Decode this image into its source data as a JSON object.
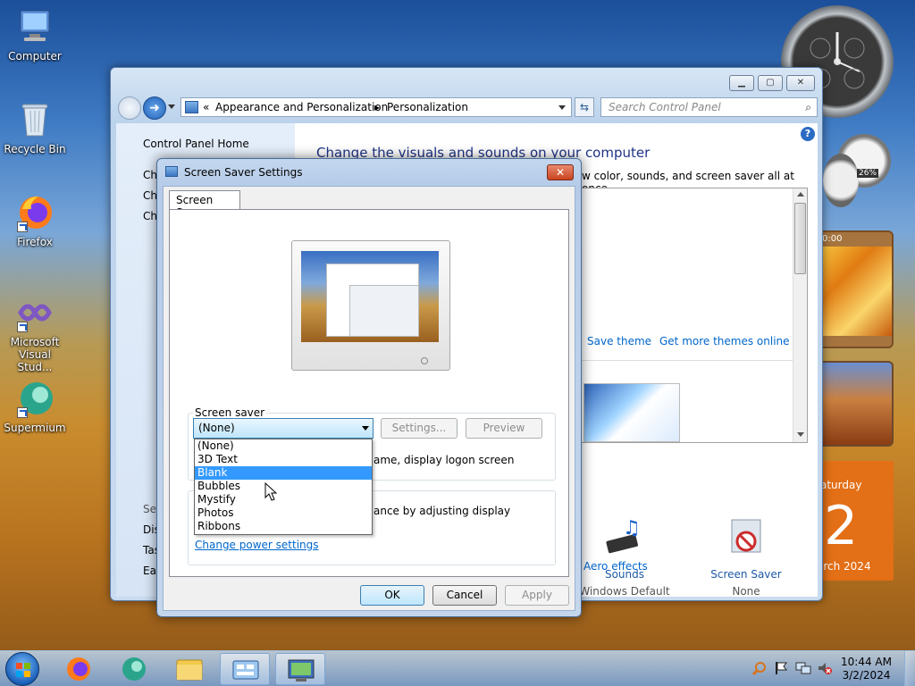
{
  "desktop": {
    "icons": [
      {
        "label": "Computer"
      },
      {
        "label": "Recycle Bin"
      },
      {
        "label": "Firefox"
      },
      {
        "label": "Microsoft Visual Stud..."
      },
      {
        "label": "Supermium"
      }
    ]
  },
  "gadgets": {
    "cpu_meter_value": "26%",
    "calendar_day_name": "aturday",
    "calendar_day": "2",
    "calendar_month": "arch 2024",
    "clock_fragment": "0:00"
  },
  "explorer": {
    "breadcrumb_prefix": "«",
    "breadcrumb": [
      "Appearance and Personalization",
      "Personalization"
    ],
    "search_placeholder": "Search Control Panel",
    "left_pane": {
      "home": "Control Panel Home",
      "partial_items": [
        "Ch",
        "Ch",
        "Ch"
      ],
      "see_also_partial": [
        "See",
        "Dis",
        "Tas",
        "Eas"
      ]
    },
    "heading": "Change the visuals and sounds on your computer",
    "subheading": "w color, sounds, and screen saver all at once.",
    "theme_links": {
      "save": "Save theme",
      "more": "Get more themes online"
    },
    "bottom_items": [
      {
        "label": "Sounds",
        "sub": "Windows Default"
      },
      {
        "label": "Screen Saver",
        "sub": "None"
      }
    ],
    "aero_link": "Aero effects"
  },
  "dialog": {
    "title": "Screen Saver Settings",
    "close_label": "✕",
    "tab": "Screen Saver",
    "group_screensaver": "Screen saver",
    "combo_value": "(None)",
    "settings_btn": "Settings...",
    "preview_btn": "Preview",
    "resume_partial": "ame, display logon screen",
    "power_partial": "ance by adjusting display",
    "power_link": "Change power settings",
    "options": [
      "(None)",
      "3D Text",
      "Blank",
      "Bubbles",
      "Mystify",
      "Photos",
      "Ribbons"
    ],
    "selected_index": 2,
    "ok": "OK",
    "cancel": "Cancel",
    "apply": "Apply"
  },
  "taskbar": {
    "time": "10:44 AM",
    "date": "3/2/2024"
  },
  "colors": {
    "accent": "#3399ff",
    "link": "#0066cc",
    "heading": "#1e3287"
  }
}
